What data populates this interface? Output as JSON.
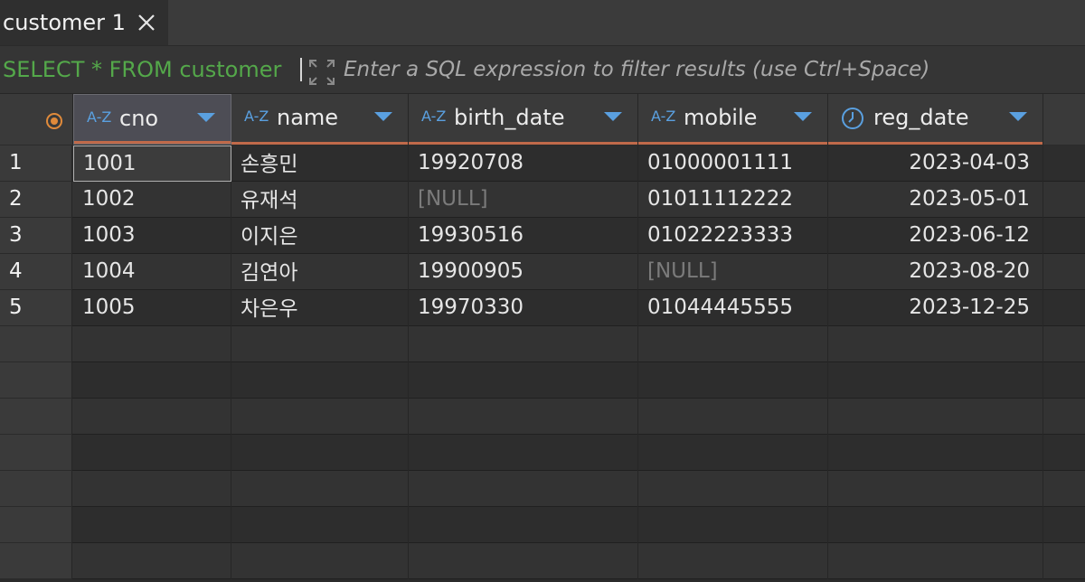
{
  "tab": {
    "label": "customer 1"
  },
  "filter": {
    "query": "SELECT * FROM customer",
    "placeholder": "Enter a SQL expression to filter results (use Ctrl+Space)"
  },
  "columns": [
    {
      "type_icon": "A-Z",
      "label": "cno"
    },
    {
      "type_icon": "A-Z",
      "label": "name"
    },
    {
      "type_icon": "A-Z",
      "label": "birth_date"
    },
    {
      "type_icon": "A-Z",
      "label": "mobile"
    },
    {
      "type_icon": "clock-icon",
      "label": "reg_date"
    }
  ],
  "rows": [
    {
      "num": "1",
      "cells": [
        "1001",
        "손흥민",
        "19920708",
        "01000001111",
        "2023-04-03"
      ]
    },
    {
      "num": "2",
      "cells": [
        "1002",
        "유재석",
        "[NULL]",
        "01011112222",
        "2023-05-01"
      ]
    },
    {
      "num": "3",
      "cells": [
        "1003",
        "이지은",
        "19930516",
        "01022223333",
        "2023-06-12"
      ]
    },
    {
      "num": "4",
      "cells": [
        "1004",
        "김연아",
        "19900905",
        "[NULL]",
        "2023-08-20"
      ]
    },
    {
      "num": "5",
      "cells": [
        "1005",
        "차은우",
        "19970330",
        "01044445555",
        "2023-12-25"
      ]
    }
  ],
  "colors": {
    "query": "#54a84a",
    "type_icon": "#5aa0e0",
    "header_underline": "#c06a4a",
    "null_text": "#7b7b7b"
  }
}
